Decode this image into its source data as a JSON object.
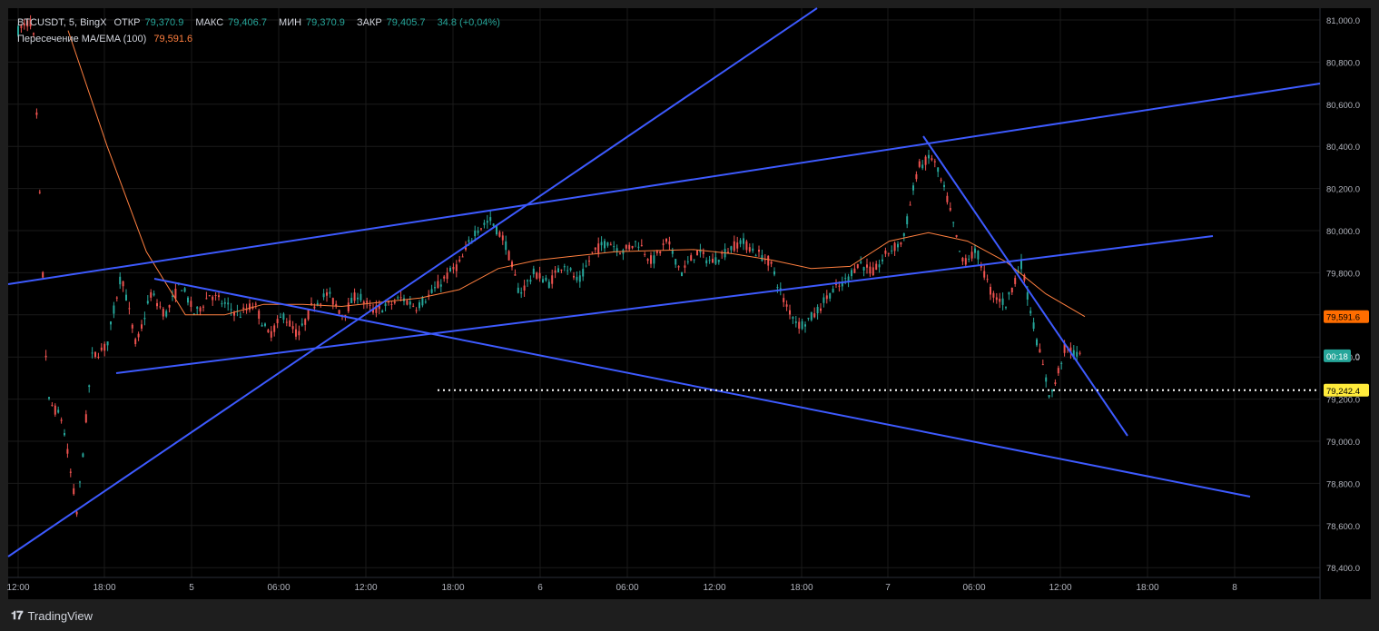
{
  "legend": {
    "symbol": "BTCUSDT, 5, BingX",
    "open_label": "ОТКР",
    "open_value": "79,370.9",
    "high_label": "МАКС",
    "high_value": "79,406.7",
    "low_label": "МИН",
    "low_value": "79,370.9",
    "close_label": "ЗАКР",
    "close_value": "79,405.7",
    "change": "34.8 (+0,04%)",
    "indicator_name": "Пересечение MA/EMA (100)",
    "indicator_value": "79,591.6"
  },
  "footer": {
    "brand": "TradingView"
  },
  "colors": {
    "up": "#26a69a",
    "down": "#ef5350",
    "ma": "#ff7f3f",
    "trendline": "#3d5afe",
    "level": "#ffeb3b",
    "grid": "#1c1c1c",
    "axis_text": "#b2b5be"
  },
  "chart_data": {
    "type": "candlestick",
    "title": "BTCUSDT, 5, BingX",
    "price_axis": {
      "labels": [
        "81,000.0",
        "80,800.0",
        "80,600.0",
        "80,400.0",
        "80,200.0",
        "80,000.0",
        "79,800.0",
        "79,600.0",
        "79,400.0",
        "79,200.0",
        "79,000.0",
        "78,800.0",
        "78,600.0",
        "78,400.0"
      ],
      "ylim": [
        78350,
        81050
      ]
    },
    "time_axis": {
      "labels": [
        "12:00",
        "18:00",
        "5",
        "06:00",
        "12:00",
        "18:00",
        "6",
        "06:00",
        "12:00",
        "18:00",
        "7",
        "06:00",
        "12:00",
        "18:00",
        "8"
      ]
    },
    "badges": {
      "ma_value": "79,591.6",
      "countdown": "00:18",
      "countdown_price": "79,405.7",
      "level_value": "79,242.4"
    },
    "level": 79242.4,
    "price_path": [
      [
        "12:00",
        80950
      ],
      [
        "15:00",
        81000
      ],
      [
        "16:00",
        79200
      ],
      [
        "17:00",
        79100
      ],
      [
        "18:00",
        78650
      ],
      [
        "18:30",
        79400
      ],
      [
        "19:00",
        79450
      ],
      [
        "20:00",
        79800
      ],
      [
        "21:00",
        79450
      ],
      [
        "22:00",
        79700
      ],
      [
        "23:00",
        79600
      ],
      [
        "5",
        79750
      ],
      [
        "01:00",
        79600
      ],
      [
        "02:00",
        79700
      ],
      [
        "03:00",
        79650
      ],
      [
        "04:00",
        79600
      ],
      [
        "05:00",
        79650
      ],
      [
        "06:00",
        79500
      ],
      [
        "07:00",
        79600
      ],
      [
        "08:00",
        79500
      ],
      [
        "09:00",
        79650
      ],
      [
        "10:00",
        79700
      ],
      [
        "11:00",
        79600
      ],
      [
        "12:00",
        79700
      ],
      [
        "13:00",
        79620
      ],
      [
        "14:00",
        79640
      ],
      [
        "15:00",
        79680
      ],
      [
        "16:00",
        79640
      ],
      [
        "17:00",
        79700
      ],
      [
        "18:00",
        79780
      ],
      [
        "19:00",
        79850
      ],
      [
        "20:00",
        80000
      ],
      [
        "21:00",
        80050
      ],
      [
        "22:00",
        79950
      ],
      [
        "23:00",
        79700
      ],
      [
        "6",
        79800
      ],
      [
        "01:00",
        79750
      ],
      [
        "02:00",
        79850
      ],
      [
        "03:00",
        79750
      ],
      [
        "04:00",
        79900
      ],
      [
        "05:00",
        79950
      ],
      [
        "06:00",
        79900
      ],
      [
        "07:00",
        79950
      ],
      [
        "08:00",
        79850
      ],
      [
        "09:00",
        79950
      ],
      [
        "10:00",
        79800
      ],
      [
        "11:00",
        79900
      ],
      [
        "12:00",
        79850
      ],
      [
        "13:00",
        79900
      ],
      [
        "14:00",
        79950
      ],
      [
        "15:00",
        79900
      ],
      [
        "16:00",
        79850
      ],
      [
        "17:00",
        79650
      ],
      [
        "18:00",
        79550
      ],
      [
        "19:00",
        79600
      ],
      [
        "20:00",
        79700
      ],
      [
        "21:00",
        79750
      ],
      [
        "22:00",
        79850
      ],
      [
        "23:00",
        79800
      ],
      [
        "7",
        79900
      ],
      [
        "01:00",
        79950
      ],
      [
        "02:00",
        80300
      ],
      [
        "03:00",
        80350
      ],
      [
        "04:00",
        80150
      ],
      [
        "05:00",
        79850
      ],
      [
        "06:00",
        79900
      ],
      [
        "07:00",
        79700
      ],
      [
        "08:00",
        79650
      ],
      [
        "09:00",
        79850
      ],
      [
        "10:00",
        79500
      ],
      [
        "11:00",
        79200
      ],
      [
        "12:00",
        79450
      ],
      [
        "13:00",
        79400
      ]
    ],
    "ma_path": [
      [
        "15:00",
        80950
      ],
      [
        "18:00",
        80400
      ],
      [
        "21:00",
        79900
      ],
      [
        "23:00",
        79600
      ],
      [
        "5",
        79600
      ],
      [
        "03:00",
        79650
      ],
      [
        "06:00",
        79650
      ],
      [
        "09:00",
        79640
      ],
      [
        "12:00",
        79660
      ],
      [
        "15:00",
        79680
      ],
      [
        "18:00",
        79720
      ],
      [
        "21:00",
        79820
      ],
      [
        "6",
        79860
      ],
      [
        "03:00",
        79880
      ],
      [
        "06:00",
        79900
      ],
      [
        "09:00",
        79905
      ],
      [
        "12:00",
        79910
      ],
      [
        "15:00",
        79890
      ],
      [
        "18:00",
        79860
      ],
      [
        "21:00",
        79820
      ],
      [
        "7",
        79830
      ],
      [
        "03:00",
        79950
      ],
      [
        "05:00",
        79990
      ],
      [
        "07:00",
        79950
      ],
      [
        "09:00",
        79850
      ],
      [
        "11:00",
        79700
      ],
      [
        "12:30",
        79591.6
      ]
    ]
  }
}
